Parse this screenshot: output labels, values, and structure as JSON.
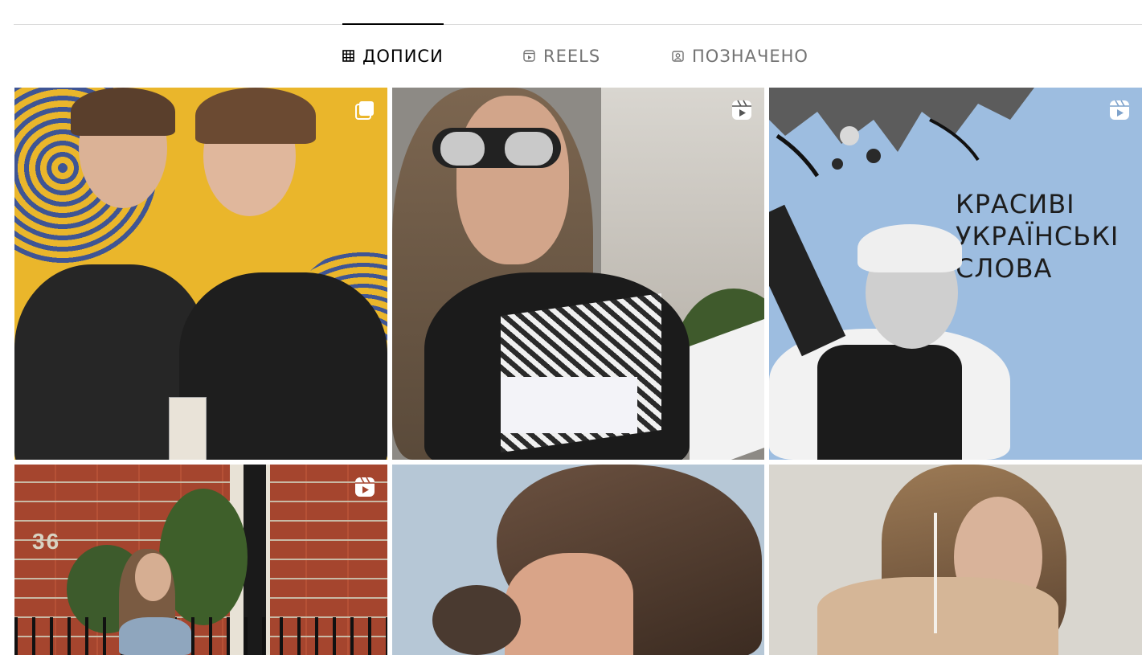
{
  "tabs": [
    {
      "label": "ДОПИСИ",
      "icon": "grid-icon",
      "active": true
    },
    {
      "label": "REELS",
      "icon": "reels-icon",
      "active": false
    },
    {
      "label": "ПОЗНАЧЕНО",
      "icon": "tagged-icon",
      "active": false
    }
  ],
  "posts": [
    {
      "badge": "carousel-icon",
      "alt_text": ""
    },
    {
      "badge": "reel-icon",
      "alt_text": ""
    },
    {
      "badge": "reel-icon",
      "headline": [
        "КРАСИВІ",
        "УКРАЇНСЬКІ",
        "СЛОВА"
      ]
    },
    {
      "badge": "reel-icon",
      "house_number": "36"
    },
    {
      "badge": "",
      "alt_text": ""
    },
    {
      "badge": "",
      "alt_text": ""
    }
  ],
  "colors": {
    "active_tab": "#000000",
    "inactive_tab": "#737373",
    "divider": "#dbdbdb"
  }
}
